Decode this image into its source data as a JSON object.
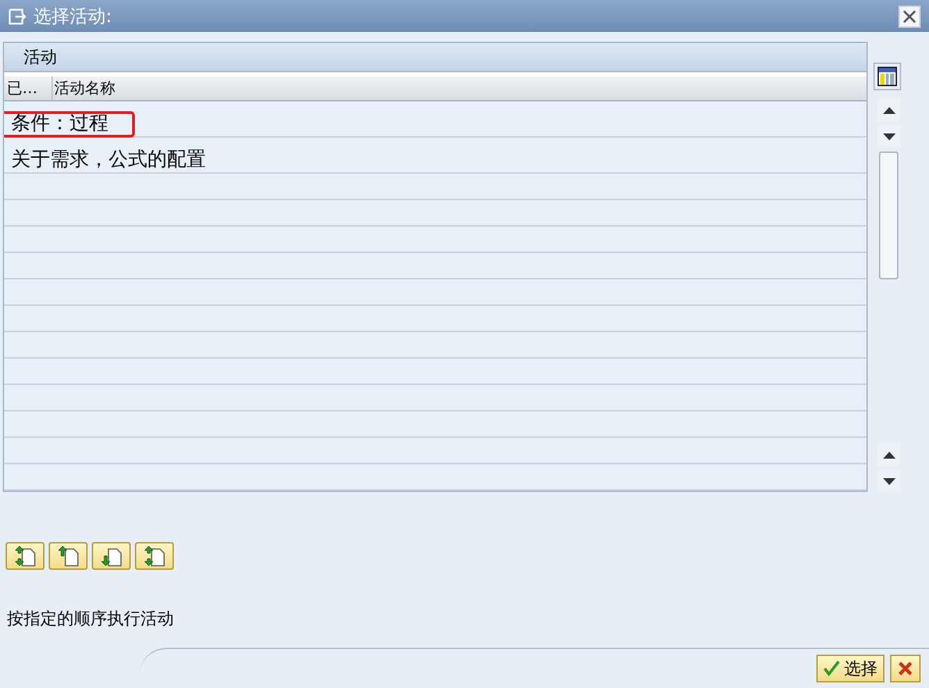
{
  "window": {
    "title": "选择活动:"
  },
  "table": {
    "title": "活动",
    "columns": [
      "已…",
      "活动名称"
    ],
    "rows": [
      {
        "column_1": "",
        "name": "条件：过程",
        "highlighted": true
      },
      {
        "column_1": "",
        "name": "关于需求，公式的配置",
        "highlighted": false
      }
    ]
  },
  "order_buttons": [
    {
      "kind": "both"
    },
    {
      "kind": "up"
    },
    {
      "kind": "down"
    },
    {
      "kind": "both"
    }
  ],
  "hint": "按指定的顺序执行活动",
  "footer_buttons": [
    {
      "kind": "confirm",
      "label": "选择"
    },
    {
      "kind": "cancel"
    }
  ]
}
